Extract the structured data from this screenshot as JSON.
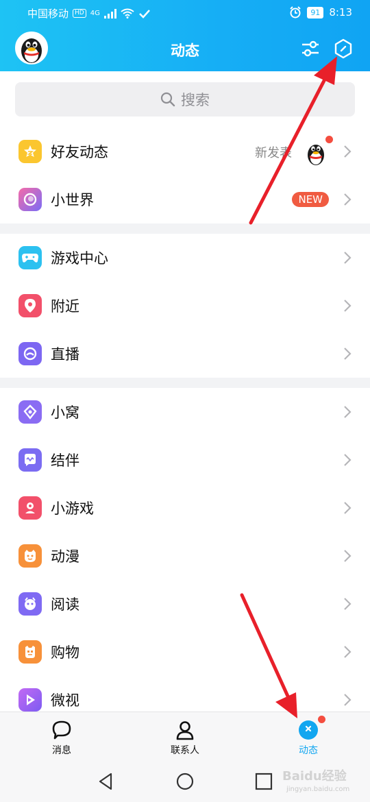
{
  "status_bar": {
    "carrier": "中国移动",
    "hd": "HD",
    "signal": "4G",
    "battery": "91",
    "time": "8:13"
  },
  "header": {
    "title": "动态"
  },
  "search": {
    "placeholder": "搜索"
  },
  "groups": [
    {
      "items": [
        {
          "label": "好友动态",
          "icon": "star-icon",
          "color": "#f9c72f",
          "sub": "新发表"
        },
        {
          "label": "小世界",
          "icon": "planet-icon",
          "color": "#8b6cf5",
          "badge": "NEW"
        }
      ]
    },
    {
      "items": [
        {
          "label": "游戏中心",
          "icon": "gamepad-icon",
          "color": "#2cc1f0"
        },
        {
          "label": "附近",
          "icon": "location-pin-icon",
          "color": "#f2506a"
        },
        {
          "label": "直播",
          "icon": "live-icon",
          "color": "#7d67f2"
        }
      ]
    },
    {
      "items": [
        {
          "label": "小窝",
          "icon": "home-icon",
          "color": "#8a6cf3"
        },
        {
          "label": "结伴",
          "icon": "chat-wave-icon",
          "color": "#7b6cf2"
        },
        {
          "label": "小游戏",
          "icon": "mini-game-icon",
          "color": "#f2506a"
        },
        {
          "label": "动漫",
          "icon": "anime-icon",
          "color": "#f7913a"
        },
        {
          "label": "阅读",
          "icon": "reading-icon",
          "color": "#7f6af3"
        },
        {
          "label": "购物",
          "icon": "shopping-icon",
          "color": "#f7913a"
        },
        {
          "label": "微视",
          "icon": "video-play-icon",
          "color": "#a663f3"
        }
      ]
    }
  ],
  "tabbar": {
    "messages": "消息",
    "contacts": "联系人",
    "feed": "动态"
  },
  "colors": {
    "header_start": "#1ec3f4",
    "header_end": "#10a4f3",
    "active_tab": "#12a6f0",
    "red_dot": "#f44d3f",
    "arrow": "#e8202a"
  },
  "watermark": {
    "text": "Baidu经验",
    "sub": "jingyan.baidu.com"
  }
}
